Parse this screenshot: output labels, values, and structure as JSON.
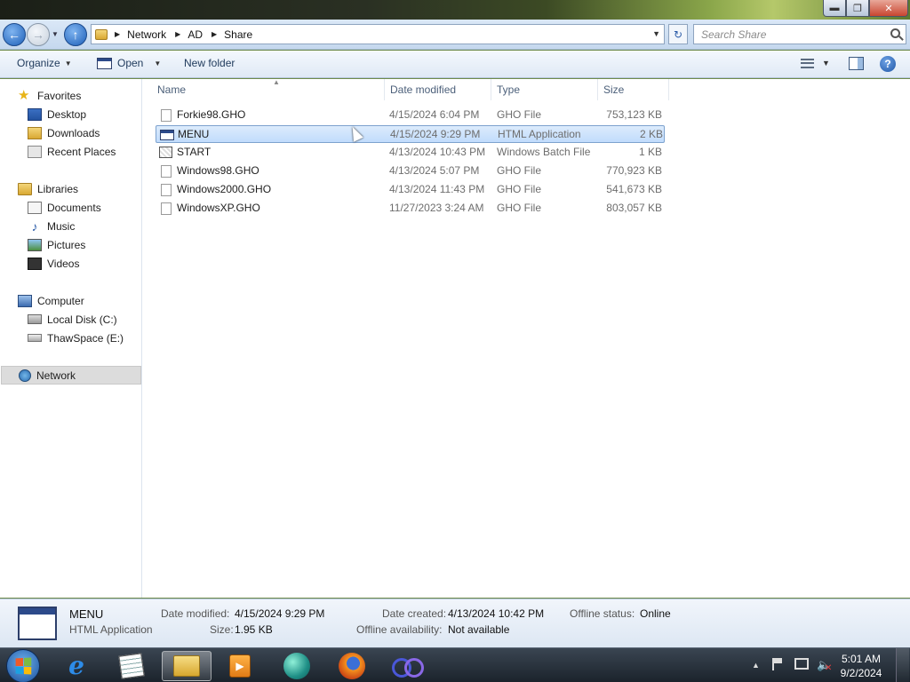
{
  "window": {
    "caption_buttons": {
      "minimize": "▬",
      "restore": "❐",
      "close": "✕"
    }
  },
  "navigation": {
    "back_glyph": "←",
    "forward_glyph": "→",
    "up_glyph": "↑",
    "breadcrumbs": [
      "Network",
      "AD",
      "Share"
    ],
    "refresh_glyph": "↻",
    "search_placeholder": "Search Share"
  },
  "toolbar": {
    "organize_label": "Organize",
    "open_label": "Open",
    "new_folder_label": "New folder",
    "help_glyph": "?"
  },
  "sidebar": {
    "favorites": {
      "label": "Favorites",
      "items": [
        "Desktop",
        "Downloads",
        "Recent Places"
      ]
    },
    "libraries": {
      "label": "Libraries",
      "items": [
        "Documents",
        "Music",
        "Pictures",
        "Videos"
      ]
    },
    "computer": {
      "label": "Computer",
      "items": [
        "Local Disk (C:)",
        "ThawSpace (E:)"
      ]
    },
    "network": {
      "label": "Network"
    }
  },
  "file_list": {
    "columns": [
      "Name",
      "Date modified",
      "Type",
      "Size"
    ],
    "rows": [
      {
        "name": "Forkie98.GHO",
        "date": "4/15/2024 6:04 PM",
        "type": "GHO File",
        "size": "753,123 KB",
        "icon": "file-icon"
      },
      {
        "name": "MENU",
        "date": "4/15/2024 9:29 PM",
        "type": "HTML Application",
        "size": "2 KB",
        "icon": "hta-icon",
        "selected": true
      },
      {
        "name": "START",
        "date": "4/13/2024 10:43 PM",
        "type": "Windows Batch File",
        "size": "1 KB",
        "icon": "batch-icon"
      },
      {
        "name": "Windows98.GHO",
        "date": "4/13/2024 5:07 PM",
        "type": "GHO File",
        "size": "770,923 KB",
        "icon": "file-icon"
      },
      {
        "name": "Windows2000.GHO",
        "date": "4/13/2024 11:43 PM",
        "type": "GHO File",
        "size": "541,673 KB",
        "icon": "file-icon"
      },
      {
        "name": "WindowsXP.GHO",
        "date": "11/27/2023 3:24 AM",
        "type": "GHO File",
        "size": "803,057 KB",
        "icon": "file-icon"
      }
    ]
  },
  "details": {
    "name": "MENU",
    "type": "HTML Application",
    "date_modified_label": "Date modified:",
    "date_modified": "4/15/2024 9:29 PM",
    "size_label": "Size:",
    "size": "1.95 KB",
    "date_created_label": "Date created:",
    "date_created": "4/13/2024 10:42 PM",
    "offline_availability_label": "Offline availability:",
    "offline_availability": "Not available",
    "offline_status_label": "Offline status:",
    "offline_status": "Online"
  },
  "taskbar": {
    "apps": [
      "internet-explorer",
      "notepad",
      "windows-explorer",
      "media-player",
      "globe-app",
      "firefox",
      "loop-app"
    ],
    "active_app": "windows-explorer",
    "media_glyph": "▶",
    "volume_glyph": "🔈",
    "mute_glyph": "✕",
    "clock_time": "5:01 AM",
    "clock_date": "9/2/2024"
  }
}
